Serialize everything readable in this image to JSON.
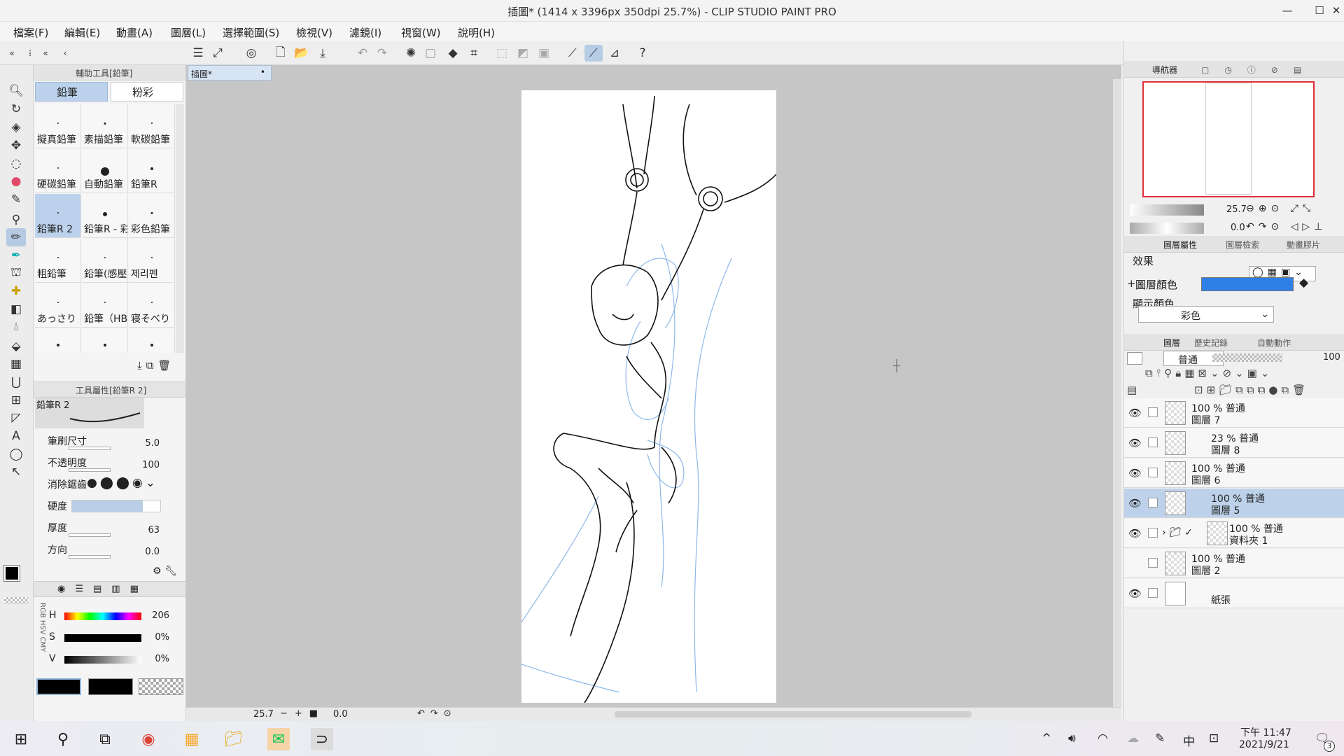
{
  "window": {
    "title": "插圖* (1414 x 3396px 350dpi 25.7%)  - CLIP STUDIO PAINT PRO"
  },
  "menu": [
    "檔案(F)",
    "編輯(E)",
    "動畫(A)",
    "圖層(L)",
    "選擇範圍(S)",
    "檢視(V)",
    "濾鏡(I)",
    "視窗(W)",
    "說明(H)"
  ],
  "subtool": {
    "panel_title": "輔助工具[鉛筆]",
    "groups": [
      "鉛筆",
      "粉彩"
    ],
    "brushes": [
      "擬真鉛筆",
      "素描鉛筆",
      "軟碳鉛筆",
      "硬碳鉛筆",
      "自動鉛筆",
      "鉛筆R",
      "鉛筆R 2",
      "鉛筆R - 彩",
      "彩色鉛筆",
      "粗鉛筆",
      "鉛筆(感壓",
      "제리펜",
      "あっさり",
      "鉛筆（HB",
      "寝そべり"
    ],
    "selected": "鉛筆R 2"
  },
  "toolprop": {
    "panel_title": "工具屬性[鉛筆R 2]",
    "brush_name": "鉛筆R 2",
    "props": [
      {
        "name": "筆刷尺寸",
        "value": "5.0"
      },
      {
        "name": "不透明度",
        "value": "100"
      },
      {
        "name": "消除鋸齒",
        "value": ""
      },
      {
        "name": "硬度",
        "value": ""
      },
      {
        "name": "厚度",
        "value": "63"
      },
      {
        "name": "方向",
        "value": "0.0"
      }
    ]
  },
  "color": {
    "mode_labels": [
      "RGB",
      "HSV",
      "CMY"
    ],
    "rows": [
      {
        "name": "H",
        "value": "206"
      },
      {
        "name": "S",
        "value": "0%"
      },
      {
        "name": "V",
        "value": "0%"
      }
    ],
    "main": "#000000"
  },
  "canvas": {
    "tab": "插圖*",
    "zoom": "25.7",
    "rotation": "0.0"
  },
  "navigator": {
    "title": "導航器",
    "zoom": "25.7",
    "rotation": "0.0"
  },
  "layerprop": {
    "tabs": [
      "圖層屬性",
      "圖層檢索",
      "動畫膠片"
    ],
    "effect_label": "效果",
    "layer_color_label": "圖層顏色",
    "layer_color": "#2f80e6",
    "display_color_label": "顯示顏色",
    "display_color_value": "彩色"
  },
  "layers": {
    "tabs": [
      "圖層",
      "歷史記錄",
      "自動動作"
    ],
    "blend_mode": "普通",
    "opacity": "100",
    "items": [
      {
        "mode": "100 % 普通",
        "name": "圖層 7"
      },
      {
        "mode": "23 % 普通",
        "name": "圖層 8"
      },
      {
        "mode": "100 % 普通",
        "name": "圖層 6"
      },
      {
        "mode": "100 % 普通",
        "name": "圖層 5"
      },
      {
        "mode": "100 % 普通",
        "name": "資料夾 1"
      },
      {
        "mode": "100 % 普通",
        "name": "圖層 2"
      },
      {
        "mode": "",
        "name": "紙張"
      }
    ]
  },
  "taskbar": {
    "ime": "中",
    "time": "下午 11:47",
    "date": "2021/9/21",
    "notifications": "3"
  }
}
